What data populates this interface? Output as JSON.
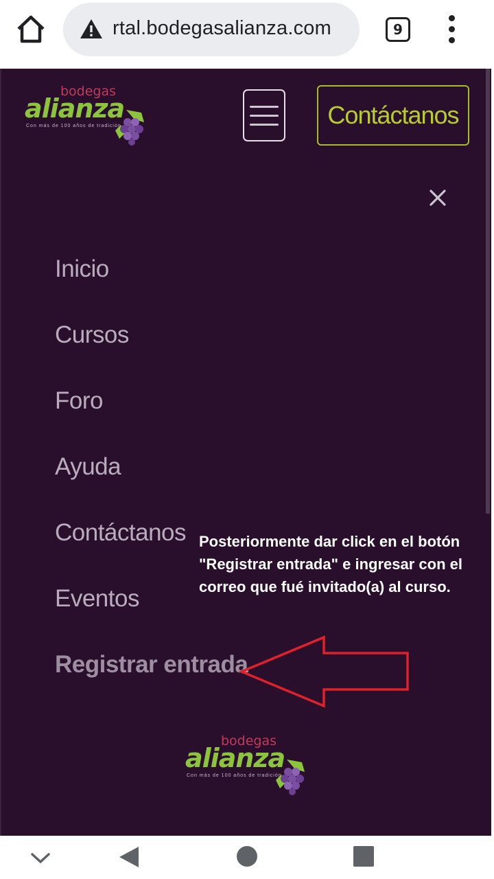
{
  "browser": {
    "url": "rtal.bodegasalianza.com",
    "tab_count": "9",
    "icons": [
      "home-icon",
      "warning-icon",
      "tab-switcher-icon",
      "more-options-icon"
    ]
  },
  "site": {
    "logo": {
      "small_text": "bodegas",
      "big_text": "alianza",
      "tagline": "Con más de 100 años de tradición"
    },
    "contact_button": "Contáctanos",
    "menu_items": [
      "Inicio",
      "Cursos",
      "Foro",
      "Ayuda",
      "Contáctanos",
      "Eventos",
      "Registrar entrada"
    ],
    "colors": {
      "background": "#2a0f2d",
      "accent": "#b8cc30",
      "menu_text": "#b9adbd",
      "annotation_arrow": "#e0202a"
    }
  },
  "annotation": {
    "text": "Posteriormente dar click en el botón \"Registrar entrada\" e ingresar con el correo que fué invitado(a) al curso."
  },
  "system_nav": {
    "icons": [
      "collapse-icon",
      "back-icon",
      "home-circle-icon",
      "recents-icon"
    ]
  }
}
